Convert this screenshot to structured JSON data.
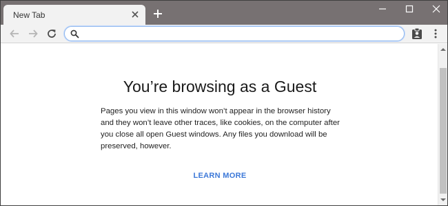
{
  "tab": {
    "title": "New Tab"
  },
  "icons": {
    "tab_close": "close-icon",
    "new_tab": "plus-icon",
    "minimize": "minimize-icon",
    "maximize": "maximize-icon",
    "close_window": "close-icon",
    "back": "arrow-left-icon",
    "forward": "arrow-right-icon",
    "reload": "reload-icon",
    "search": "search-icon",
    "profile": "guest-profile-icon",
    "menu": "more-vertical-icon"
  },
  "omnibox": {
    "value": "",
    "placeholder": ""
  },
  "content": {
    "title": "You’re browsing as a Guest",
    "description": "Pages you view in this window won’t appear in the browser history and they won’t leave other traces, like cookies, on the computer after you close all open Guest windows. Any files you download will be preserved, however.",
    "learn_more": "LEARN MORE"
  },
  "colors": {
    "frame": "#777172",
    "toolbar": "#f2f2f2",
    "link": "#3c78d8",
    "omnibox_focus": "#90b8ee"
  }
}
